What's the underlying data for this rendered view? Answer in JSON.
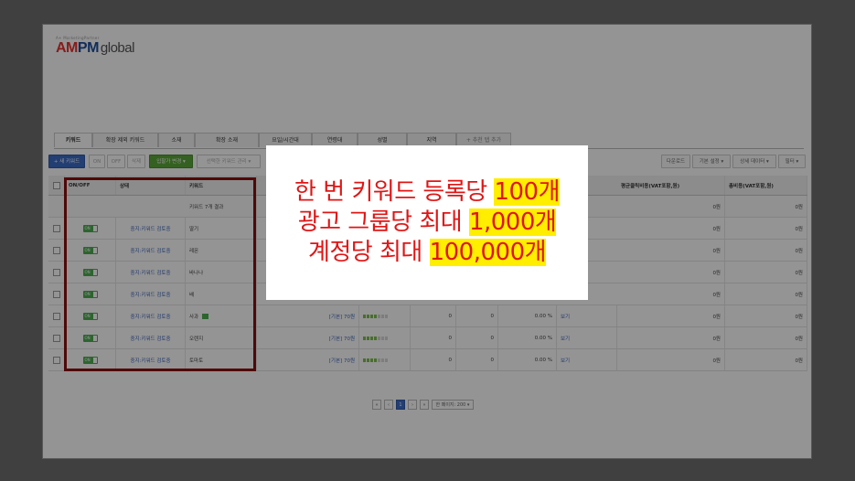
{
  "logo": {
    "tagline": "A+ MarketingPartner",
    "am": "AM",
    "pm": "PM",
    "global": "global"
  },
  "tabs": [
    {
      "label": "키워드"
    },
    {
      "label": "확장 제외 키워드"
    },
    {
      "label": "소재"
    },
    {
      "label": "확장 소재"
    },
    {
      "label": "요일/시간대"
    },
    {
      "label": "연령대"
    },
    {
      "label": "성별"
    },
    {
      "label": "지역"
    },
    {
      "label": "+ 추천 탭 추가"
    }
  ],
  "toolbar": {
    "new_keyword": "+ 새 키워드",
    "on": "ON",
    "off": "OFF",
    "delete": "삭제",
    "bid_change": "입찰가 변경 ▾",
    "selected_keyword": "선택한 키워드 관리 ▾",
    "download": "다운로드",
    "basic_settings": "기본 설정 ▾",
    "detail_data": "상세 데이터 ▾",
    "filter": "필터 ▾"
  },
  "columns": {
    "onoff": "ON/OFF",
    "status": "상태",
    "keyword": "키워드",
    "avg_cost": "평균클릭비용(VAT포함,원)",
    "total_cost": "총비용(VAT포함,원)"
  },
  "summary_row": {
    "label": "키워드 7개 결과",
    "avg_cost": "0원",
    "total_cost": "0원"
  },
  "rows": [
    {
      "toggle": "ON",
      "status": "중지:키워드 검토중",
      "keyword": "딸기",
      "badge": false,
      "bid": "",
      "cost_avg": "0원",
      "cost_total": "0원"
    },
    {
      "toggle": "ON",
      "status": "중지:키워드 검토중",
      "keyword": "레몬",
      "badge": false,
      "bid": "",
      "cost_avg": "0원",
      "cost_total": "0원"
    },
    {
      "toggle": "ON",
      "status": "중지:키워드 검토중",
      "keyword": "바나나",
      "badge": false,
      "bid": "",
      "cost_avg": "0원",
      "cost_total": "0원"
    },
    {
      "toggle": "ON",
      "status": "중지:키워드 검토중",
      "keyword": "배",
      "badge": false,
      "bid": "",
      "cost_avg": "0원",
      "cost_total": "0원"
    },
    {
      "toggle": "ON",
      "status": "중지:키워드 검토중",
      "keyword": "사과",
      "badge": true,
      "bid": "[기본] 70원",
      "imp": "0",
      "clk": "0",
      "ctr": "0.00 %",
      "view": "보기",
      "cost_avg": "0원",
      "cost_total": "0원"
    },
    {
      "toggle": "ON",
      "status": "중지:키워드 검토중",
      "keyword": "오렌지",
      "badge": false,
      "bid": "[기본] 70원",
      "imp": "0",
      "clk": "0",
      "ctr": "0.00 %",
      "view": "보기",
      "cost_avg": "0원",
      "cost_total": "0원"
    },
    {
      "toggle": "ON",
      "status": "중지:키워드 검토중",
      "keyword": "토마토",
      "badge": false,
      "bid": "[기본] 70원",
      "imp": "0",
      "clk": "0",
      "ctr": "0.00 %",
      "view": "보기",
      "cost_avg": "0원",
      "cost_total": "0원"
    }
  ],
  "pager": {
    "page": "1",
    "per_page": "한 페이지: 200 ▾"
  },
  "popup": {
    "line1_a": "한 번 키워드 등록당 ",
    "line1_b": "100개",
    "line2_a": "광고 그룹당 최대 ",
    "line2_b": "1,000개",
    "line3_a": "계정당 최대 ",
    "line3_b": "100,000개"
  },
  "colors": {
    "highlight": "#ffee00",
    "popup_text": "#e01515",
    "box_border": "#8b0e0e",
    "primary": "#3b6cc7"
  }
}
